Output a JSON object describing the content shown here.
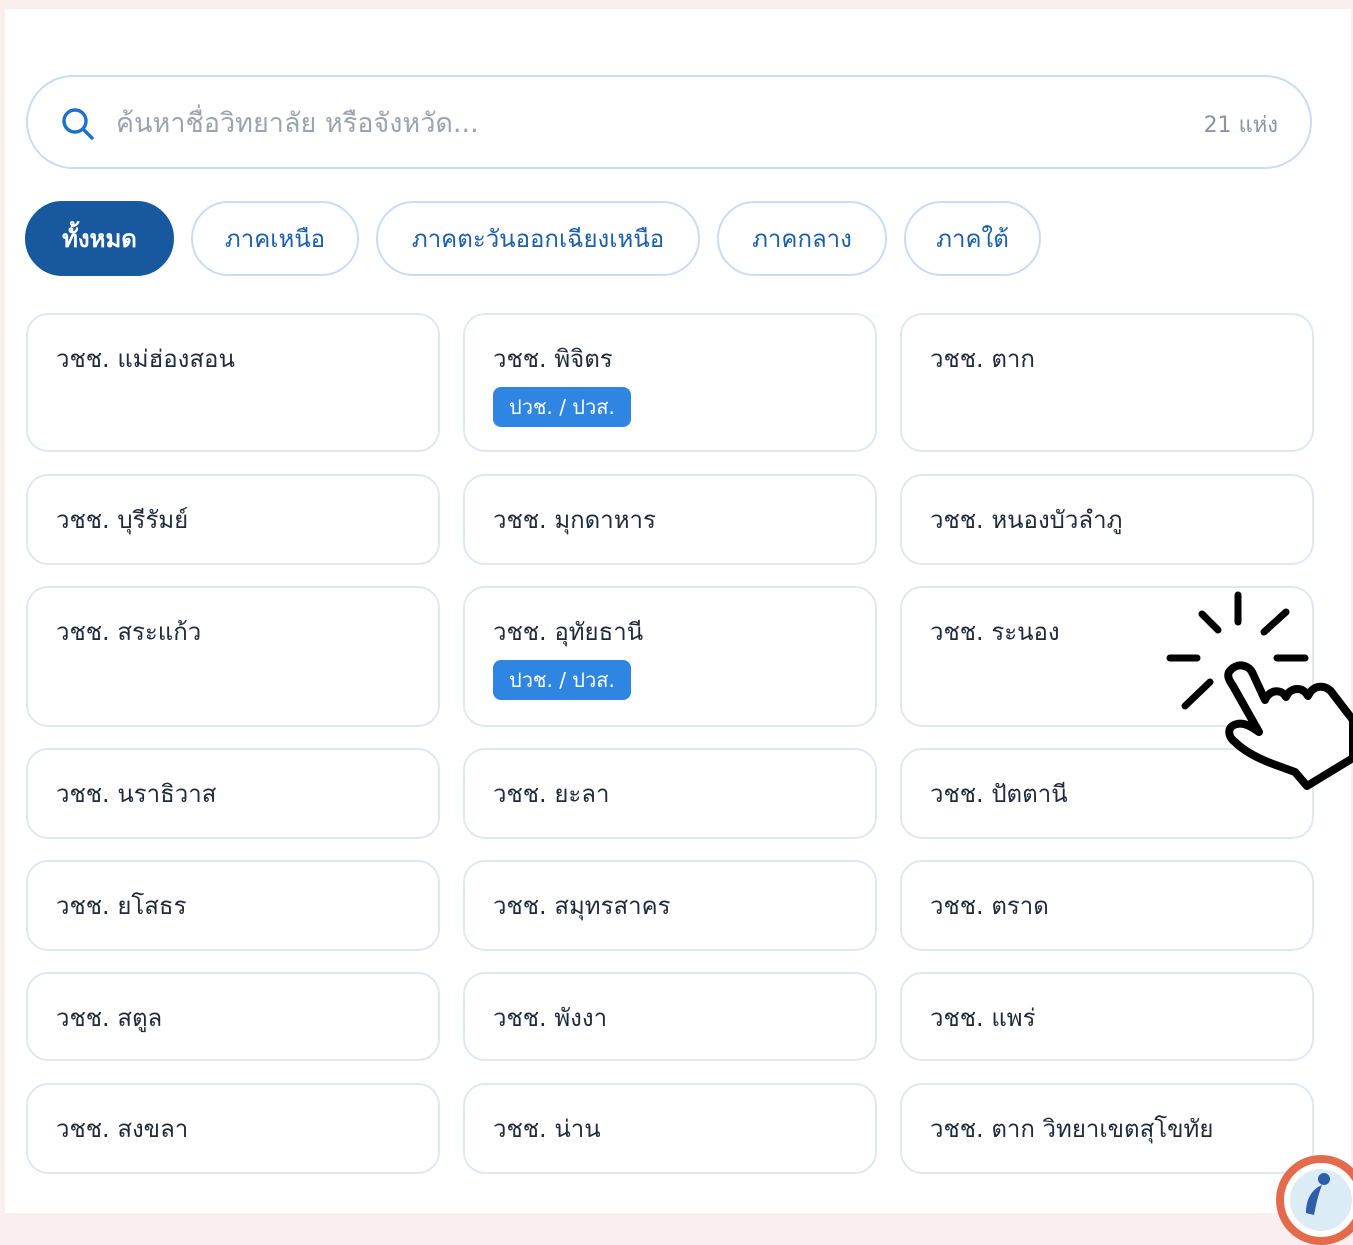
{
  "search": {
    "placeholder": "ค้นหาชื่อวิทยาลัย หรือจังหวัด...",
    "value": "",
    "count": "21 แห่ง"
  },
  "filters": [
    {
      "label": "ทั้งหมด",
      "active": true
    },
    {
      "label": "ภาคเหนือ",
      "active": false
    },
    {
      "label": "ภาคตะวันออกเฉียงเหนือ",
      "active": false
    },
    {
      "label": "ภาคกลาง",
      "active": false
    },
    {
      "label": "ภาคใต้",
      "active": false
    }
  ],
  "colleges": [
    {
      "name": "วชช. แม่ฮ่องสอน",
      "badge": ""
    },
    {
      "name": "วชช. พิจิตร",
      "badge": "ปวช. / ปวส."
    },
    {
      "name": "วชช. ตาก",
      "badge": ""
    },
    {
      "name": "วชช. บุรีรัมย์",
      "badge": ""
    },
    {
      "name": "วชช. มุกดาหาร",
      "badge": ""
    },
    {
      "name": "วชช. หนองบัวลำภู",
      "badge": ""
    },
    {
      "name": "วชช. สระแก้ว",
      "badge": ""
    },
    {
      "name": "วชช. อุทัยธานี",
      "badge": "ปวช. / ปวส."
    },
    {
      "name": "วชช. ระนอง",
      "badge": ""
    },
    {
      "name": "วชช. นราธิวาส",
      "badge": ""
    },
    {
      "name": "วชช. ยะลา",
      "badge": ""
    },
    {
      "name": "วชช. ปัตตานี",
      "badge": ""
    },
    {
      "name": "วชช. ยโสธร",
      "badge": ""
    },
    {
      "name": "วชช. สมุทรสาคร",
      "badge": ""
    },
    {
      "name": "วชช. ตราด",
      "badge": ""
    },
    {
      "name": "วชช. สตูล",
      "badge": ""
    },
    {
      "name": "วชช. พังงา",
      "badge": ""
    },
    {
      "name": "วชช. แพร่",
      "badge": ""
    },
    {
      "name": "วชช. สงขลา",
      "badge": ""
    },
    {
      "name": "วชช. น่าน",
      "badge": ""
    },
    {
      "name": "วชช. ตาก วิทยาเขตสุโขทัย",
      "badge": ""
    }
  ],
  "colors": {
    "primary": "#17589f",
    "chip_text": "#1c5ea8",
    "chip_border": "#c8dcf3",
    "badge": "#2f86e2",
    "card_border": "#dde8f4",
    "page_bg": "#fbeeee"
  },
  "icons": {
    "search": "search-icon",
    "pointer": "pointer-hand-icon",
    "helper": "help-bubble-icon"
  }
}
